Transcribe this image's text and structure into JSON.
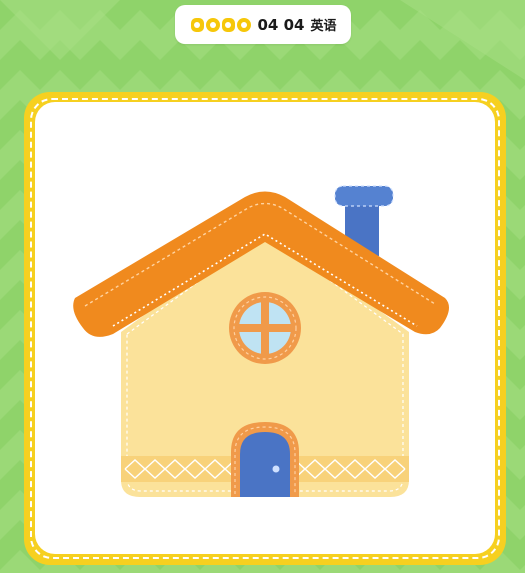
{
  "brand": {
    "logo_letters": "DODO",
    "logo_numbers": "04 04",
    "name_cn": "英语"
  },
  "illustration": {
    "subject": "house",
    "icon": "house-icon"
  },
  "colors": {
    "background_green": "#8fd36a",
    "frame_yellow": "#f6d020",
    "roof_orange": "#f08a1e",
    "wall_cream": "#fbe29a",
    "chimney_blue": "#4a74c5",
    "door_blue": "#4a74c5",
    "window_light_blue": "#bfe3f3"
  }
}
